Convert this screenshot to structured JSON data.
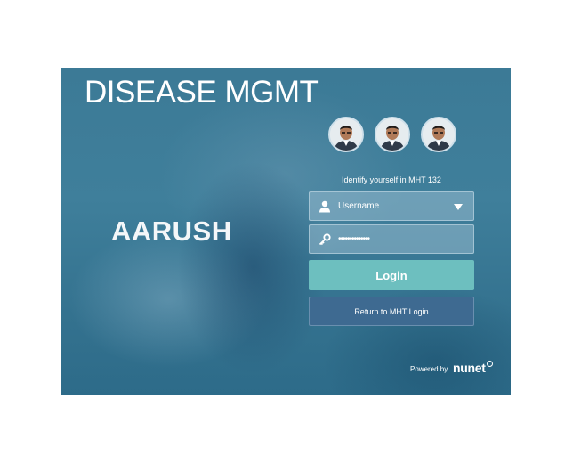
{
  "app": {
    "title": "DISEASE MGMT",
    "brand": "AARUSH"
  },
  "login": {
    "identify_text": "Identify yourself in MHT 132",
    "username_value": "Username",
    "password_value": "••••••••••••••",
    "login_label": "Login",
    "return_label": "Return to MHT Login"
  },
  "users": [
    {
      "icon": "user-avatar"
    },
    {
      "icon": "user-avatar"
    },
    {
      "icon": "user-avatar"
    }
  ],
  "footer": {
    "powered_by": "Powered by",
    "logo": "nunet"
  },
  "colors": {
    "background": "#3c7a96",
    "login_button": "#6dbfbf",
    "return_button": "#3e6a91"
  }
}
